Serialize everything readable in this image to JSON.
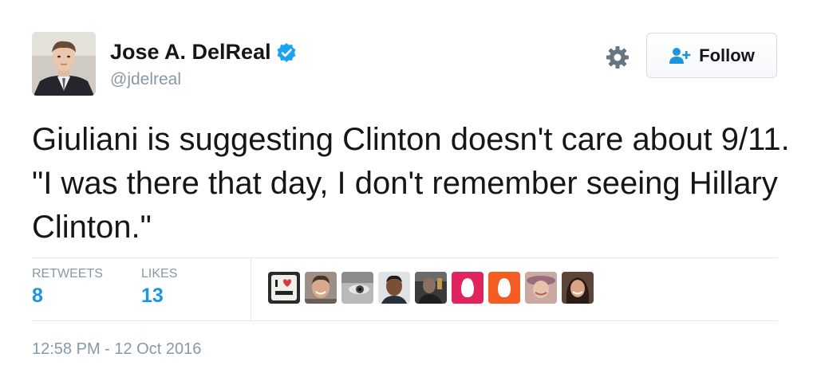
{
  "author": {
    "name": "Jose A. DelReal",
    "handle": "@jdelreal",
    "verified": true,
    "avatar_icon": "profile-photo"
  },
  "actions": {
    "settings_icon": "gear-icon",
    "follow_label": "Follow",
    "follow_icon": "add-person-icon"
  },
  "tweet": {
    "text": "Giuliani is suggesting Clinton doesn't care about 9/11. \"I was there that day, I don't remember seeing Hillary Clinton.\""
  },
  "stats": {
    "retweets_label": "RETWEETS",
    "retweets_count": "8",
    "likes_label": "LIKES",
    "likes_count": "13"
  },
  "likers": [
    {
      "icon": "i-love-voting-badge-avatar"
    },
    {
      "icon": "smiling-man-avatar"
    },
    {
      "icon": "eye-closeup-avatar"
    },
    {
      "icon": "man-portrait-avatar"
    },
    {
      "icon": "dark-figure-avatar"
    },
    {
      "icon": "pink-egg-avatar"
    },
    {
      "icon": "orange-egg-avatar"
    },
    {
      "icon": "woman-hat-avatar"
    },
    {
      "icon": "woman-smiling-avatar"
    }
  ],
  "timestamp": "12:58 PM - 12 Oct 2016",
  "colors": {
    "accent": "#1b95e0",
    "verified": "#1da1f2",
    "muted": "#8899a6",
    "text": "#14171a",
    "divider": "#e1e8ed"
  }
}
